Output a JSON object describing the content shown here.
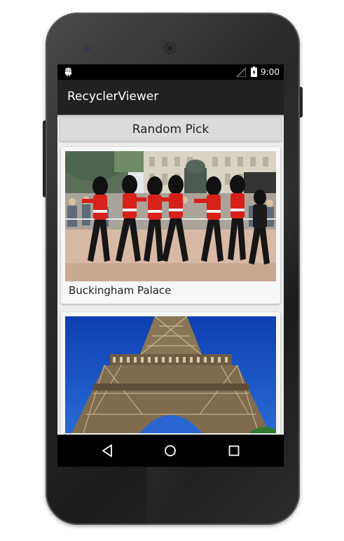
{
  "status_bar": {
    "time": "9:00",
    "icons": [
      "android-notification-icon",
      "signal-icon",
      "battery-icon"
    ]
  },
  "toolbar": {
    "title": "RecyclerViewer"
  },
  "content": {
    "random_button_label": "Random Pick",
    "cards": [
      {
        "caption": "Buckingham Palace",
        "image": "queens-guards-marching-photo"
      },
      {
        "caption": "",
        "image": "eiffel-tower-photo"
      }
    ]
  },
  "nav_bar": {
    "buttons": [
      "back-icon",
      "home-icon",
      "recents-icon"
    ]
  },
  "colors": {
    "toolbar": "#212121",
    "status_bar": "#000000",
    "background": "#ededed",
    "button": "#dcdcdc",
    "card": "#f7f7f7"
  }
}
